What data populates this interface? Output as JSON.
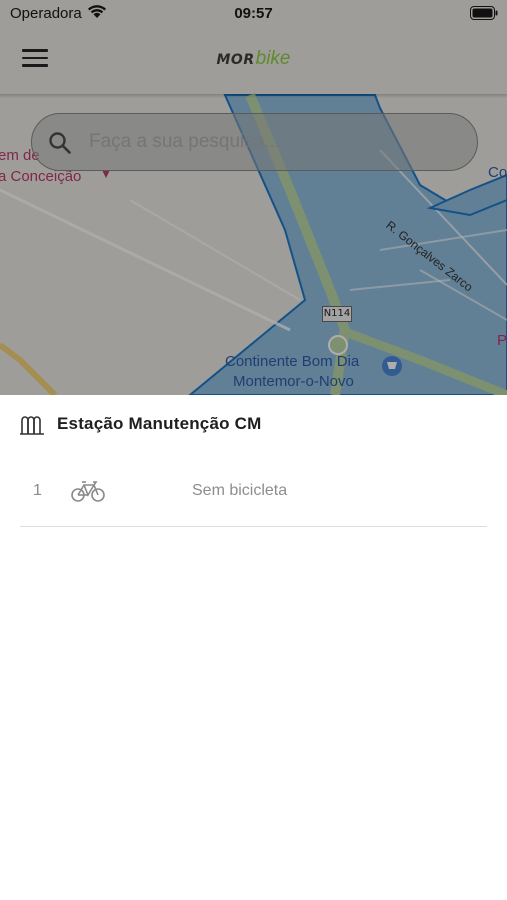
{
  "status_bar": {
    "carrier": "Operadora",
    "time": "09:57"
  },
  "header": {
    "logo_mor": "MOR",
    "logo_bike": "bike",
    "menu_icon": "hamburger-menu-icon",
    "brand_color": "#5f8a2e"
  },
  "search": {
    "placeholder": "Faça a sua pesquisa..."
  },
  "map": {
    "labels": {
      "place_line1": "em de",
      "place_line2": "a Conceição",
      "street": "R. Gonçalves Zarco",
      "road_shield": "N114",
      "store_line1": "Continente Bom Dia",
      "store_line2": "Montemor-o-Novo",
      "edge_right_top": "Co",
      "edge_right_mid": "P"
    },
    "zone_color": "#8bb8d8",
    "zone_border": "#1f78c9"
  },
  "station": {
    "icon": "bike-rack-icon",
    "name": "Estação Manutenção CM",
    "slots": [
      {
        "number": "1",
        "icon": "bicycle-icon",
        "status": "Sem bicicleta"
      }
    ]
  }
}
